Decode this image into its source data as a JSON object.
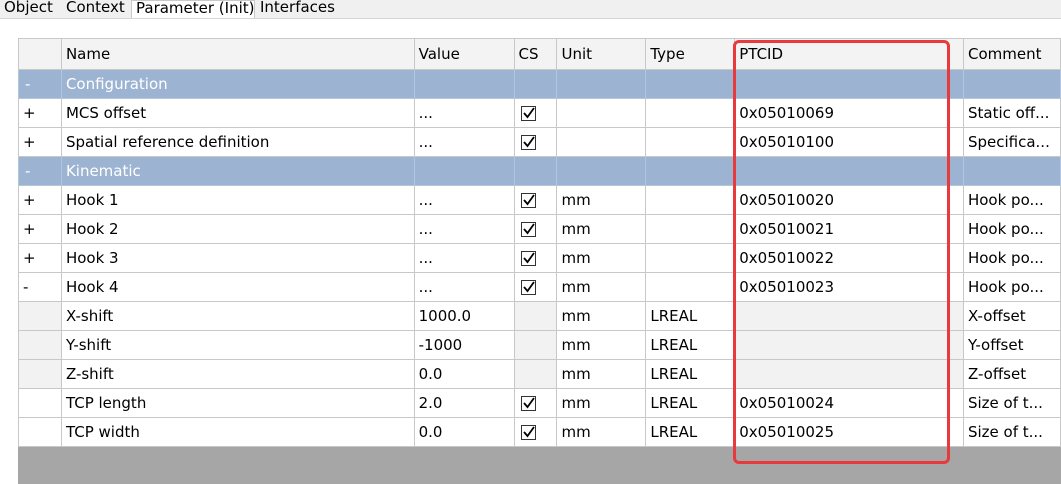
{
  "tabs": [
    "Object",
    "Context",
    "Parameter (Init)",
    "Interfaces"
  ],
  "columns": {
    "name": "Name",
    "value": "Value",
    "cs": "CS",
    "unit": "Unit",
    "type": "Type",
    "ptcid": "PTCID",
    "comment": "Comment"
  },
  "rows": [
    {
      "kind": "cat",
      "exp": "-",
      "name": "Configuration"
    },
    {
      "kind": "row",
      "exp": "+",
      "name": "MCS offset",
      "value": "...",
      "cs": true,
      "unit": "",
      "type": "",
      "ptcid": "0x05010069",
      "comment": "Static off..."
    },
    {
      "kind": "row",
      "exp": "+",
      "name": "Spatial reference definition",
      "value": "...",
      "cs": true,
      "unit": "",
      "type": "",
      "ptcid": "0x05010100",
      "comment": "Specifica..."
    },
    {
      "kind": "cat",
      "exp": "-",
      "name": "Kinematic"
    },
    {
      "kind": "row",
      "exp": "+",
      "name": "Hook 1",
      "value": "...",
      "cs": true,
      "unit": "mm",
      "type": "",
      "ptcid": "0x05010020",
      "comment": "Hook po..."
    },
    {
      "kind": "row",
      "exp": "+",
      "name": "Hook 2",
      "value": "...",
      "cs": true,
      "unit": "mm",
      "type": "",
      "ptcid": "0x05010021",
      "comment": "Hook po..."
    },
    {
      "kind": "row",
      "exp": "+",
      "name": "Hook 3",
      "value": "...",
      "cs": true,
      "unit": "mm",
      "type": "",
      "ptcid": "0x05010022",
      "comment": "Hook po..."
    },
    {
      "kind": "row",
      "exp": "-",
      "name": "Hook 4",
      "value": "...",
      "cs": true,
      "unit": "mm",
      "type": "",
      "ptcid": "0x05010023",
      "comment": "Hook po..."
    },
    {
      "kind": "child",
      "exp": "",
      "name": "X-shift",
      "value": "1000.0",
      "cs": null,
      "unit": "mm",
      "type": "LREAL",
      "ptcid": "",
      "comment": "X-offset"
    },
    {
      "kind": "child",
      "exp": "",
      "name": "Y-shift",
      "value": "-1000",
      "cs": null,
      "unit": "mm",
      "type": "LREAL",
      "ptcid": "",
      "comment": "Y-offset"
    },
    {
      "kind": "child",
      "exp": "",
      "name": "Z-shift",
      "value": "0.0",
      "cs": null,
      "unit": "mm",
      "type": "LREAL",
      "ptcid": "",
      "comment": "Z-offset"
    },
    {
      "kind": "row",
      "exp": "",
      "name": "TCP length",
      "value": "2.0",
      "cs": true,
      "unit": "mm",
      "type": "LREAL",
      "ptcid": "0x05010024",
      "comment": "Size of t..."
    },
    {
      "kind": "row",
      "exp": "",
      "name": "TCP width",
      "value": "0.0",
      "cs": true,
      "unit": "mm",
      "type": "LREAL",
      "ptcid": "0x05010025",
      "comment": "Size of t..."
    }
  ],
  "colors": {
    "category_bg": "#9cb4d2",
    "highlight": "#e8393c",
    "grid_bg": "#a6a6a6"
  }
}
